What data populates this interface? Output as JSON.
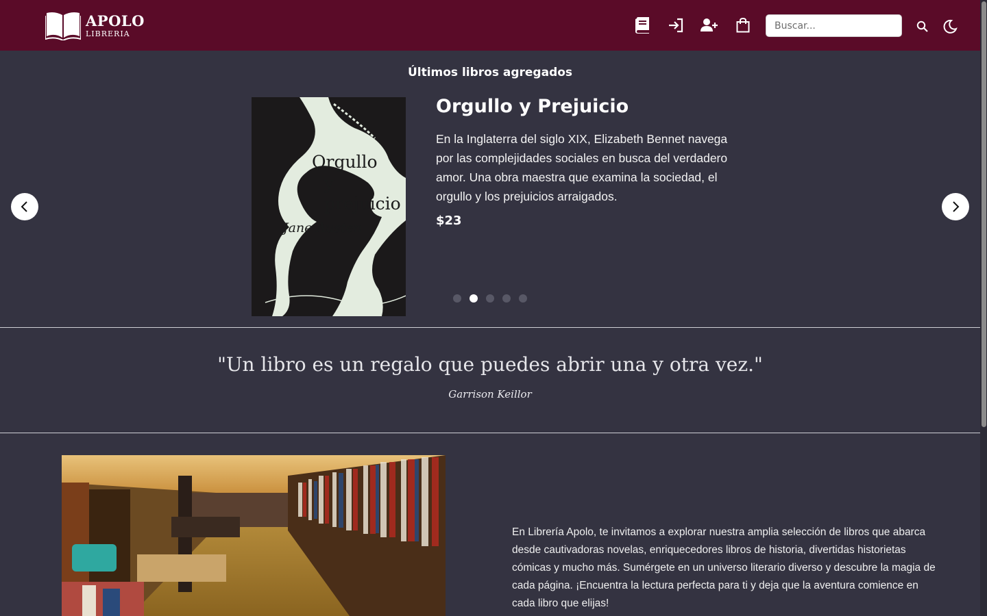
{
  "header": {
    "brand_name": "APOLO",
    "brand_sub": "LIBRERIA",
    "icons": [
      "book-icon",
      "login-icon",
      "add-user-icon",
      "shopping-bag-icon"
    ],
    "search_placeholder": "Buscar...",
    "search_icon": "search-icon",
    "theme_icon": "moon-icon",
    "colors": {
      "navbar": "#5a0b28",
      "background": "#343341"
    }
  },
  "carousel": {
    "section_title": "Últimos libros agregados",
    "cover": {
      "title_line1": "Orgullo",
      "title_line2": "y prejuicio",
      "author": "Jane Austen"
    },
    "book_title": "Orgullo y Prejuicio",
    "description": "En la Inglaterra del siglo XIX, Elizabeth Bennet navega por las complejidades sociales en busca del verdadero amor. Una obra maestra que examina la sociedad, el orgullo y los prejuicios arraigados.",
    "price": "$23",
    "slide_count": 5,
    "active_slide": 2,
    "prev_icon": "chevron-left-icon",
    "next_icon": "chevron-right-icon"
  },
  "quote": {
    "text": "\"Un libro es un regalo que puedes abrir una y otra vez.\"",
    "author": "Garrison Keillor"
  },
  "about": {
    "text": "En Librería Apolo, te invitamos a explorar nuestra amplia selección de libros que abarca desde cautivadoras novelas, enriquecedores libros de historia, divertidas historietas cómicas y mucho más. Sumérgete en un universo literario diverso y descubre la magia de cada página. ¡Encuentra la lectura perfecta para ti y deja que la aventura comience en cada libro que elijas!"
  }
}
